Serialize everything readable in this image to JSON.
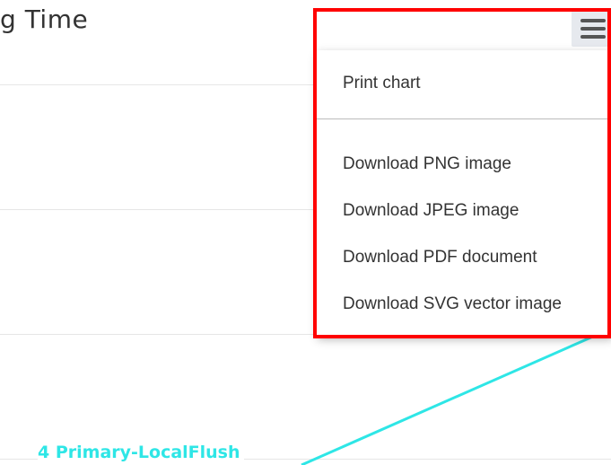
{
  "chart": {
    "title": "Time",
    "title_prefix_glyph": "g",
    "series_label": "4 Primary-LocalFlush",
    "series_color": "#2ee6e6"
  },
  "menu_button": {
    "icon": "hamburger-menu-icon"
  },
  "export_menu": {
    "items": [
      {
        "label": "Print chart"
      },
      {
        "label": "Download PNG image"
      },
      {
        "label": "Download JPEG image"
      },
      {
        "label": "Download PDF document"
      },
      {
        "label": "Download SVG vector image"
      }
    ]
  },
  "annotation": {
    "highlight_color": "#ff0000"
  }
}
